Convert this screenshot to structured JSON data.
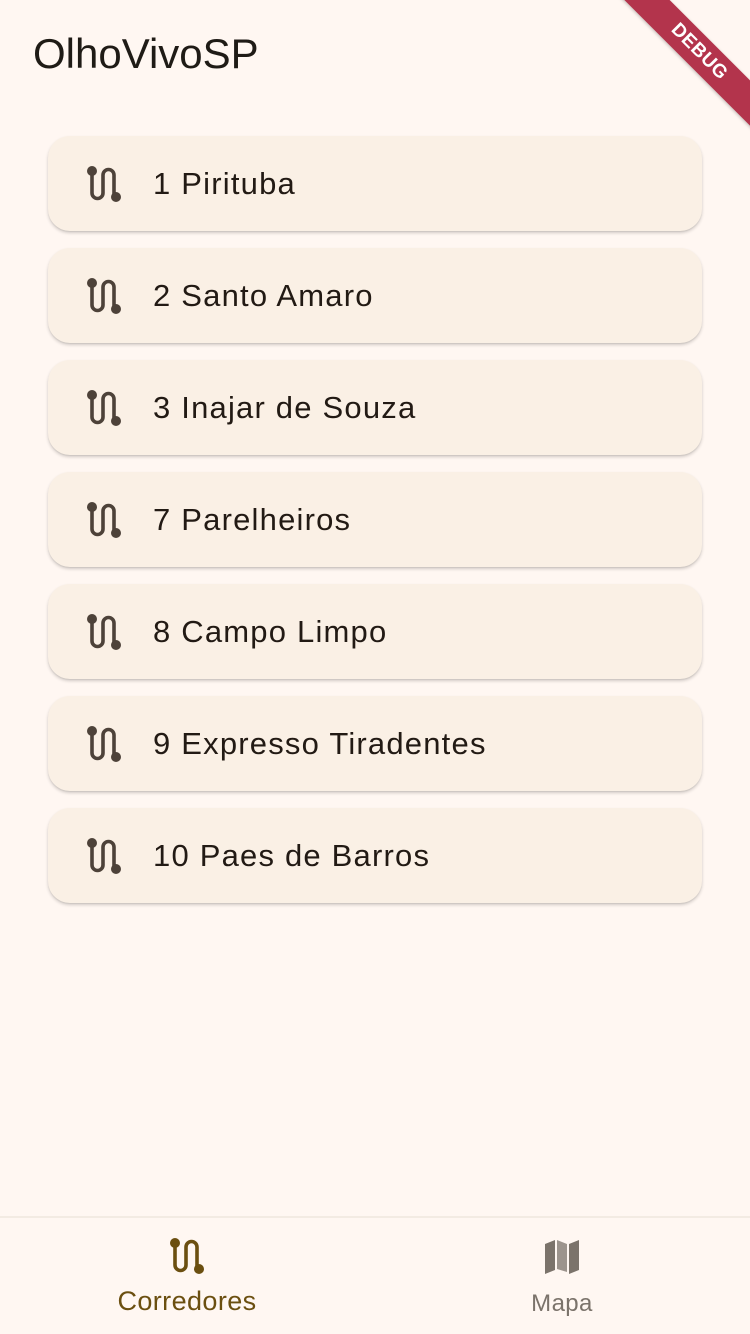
{
  "app": {
    "title": "OlhoVivoSP",
    "debug_banner": "DEBUG"
  },
  "corridors": [
    {
      "label": "1 Pirituba",
      "icon": "route-icon"
    },
    {
      "label": "2 Santo Amaro",
      "icon": "route-icon"
    },
    {
      "label": "3 Inajar de Souza",
      "icon": "route-icon"
    },
    {
      "label": "7 Parelheiros",
      "icon": "route-icon"
    },
    {
      "label": "8 Campo Limpo",
      "icon": "route-icon"
    },
    {
      "label": "9 Expresso Tiradentes",
      "icon": "route-icon"
    },
    {
      "label": "10 Paes de Barros",
      "icon": "route-icon"
    }
  ],
  "bottom_nav": {
    "items": [
      {
        "label": "Corredores",
        "icon": "route-icon",
        "active": true
      },
      {
        "label": "Mapa",
        "icon": "map-icon",
        "active": false
      }
    ]
  },
  "colors": {
    "background": "#fff7f2",
    "card": "#faf0e5",
    "icon": "#4d4239",
    "active_nav": "#6b4f10",
    "inactive_nav": "#7b736b",
    "debug_banner": "#b3344c"
  }
}
